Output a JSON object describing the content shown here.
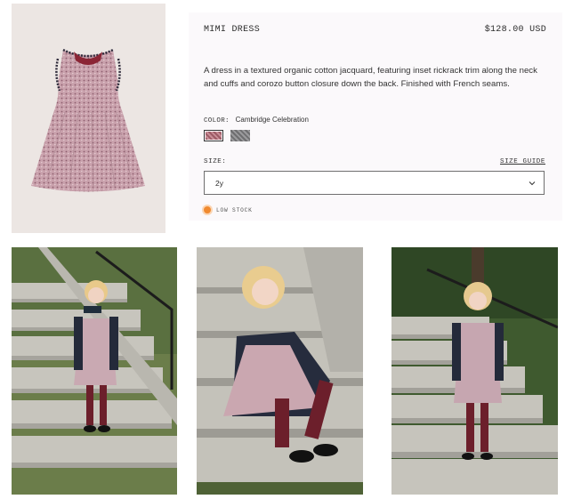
{
  "product": {
    "title": "MIMI DRESS",
    "price": "$128.00 USD",
    "description": "A dress in a textured organic cotton jacquard, featuring inset rickrack trim along the neck and cuffs and corozo button closure down the back. Finished with French seams."
  },
  "color": {
    "label": "COLOR:",
    "selected": "Cambridge Celebration",
    "swatches": [
      {
        "name": "cambridge-celebration",
        "hex": "#a7646f",
        "selected": true
      },
      {
        "name": "grey-pattern",
        "hex": "#7d7d7f",
        "selected": false
      }
    ]
  },
  "size": {
    "label": "SIZE:",
    "guide_label": "SIZE GUIDE",
    "selected": "2y"
  },
  "stock": {
    "label": "LOW STOCK",
    "color": "#f08a30"
  },
  "colors": {
    "panel_bg": "#fbf9fb",
    "text": "#2b2b2b"
  },
  "icons": {
    "select": "chevron-down-icon",
    "stock": "status-dot-icon"
  }
}
